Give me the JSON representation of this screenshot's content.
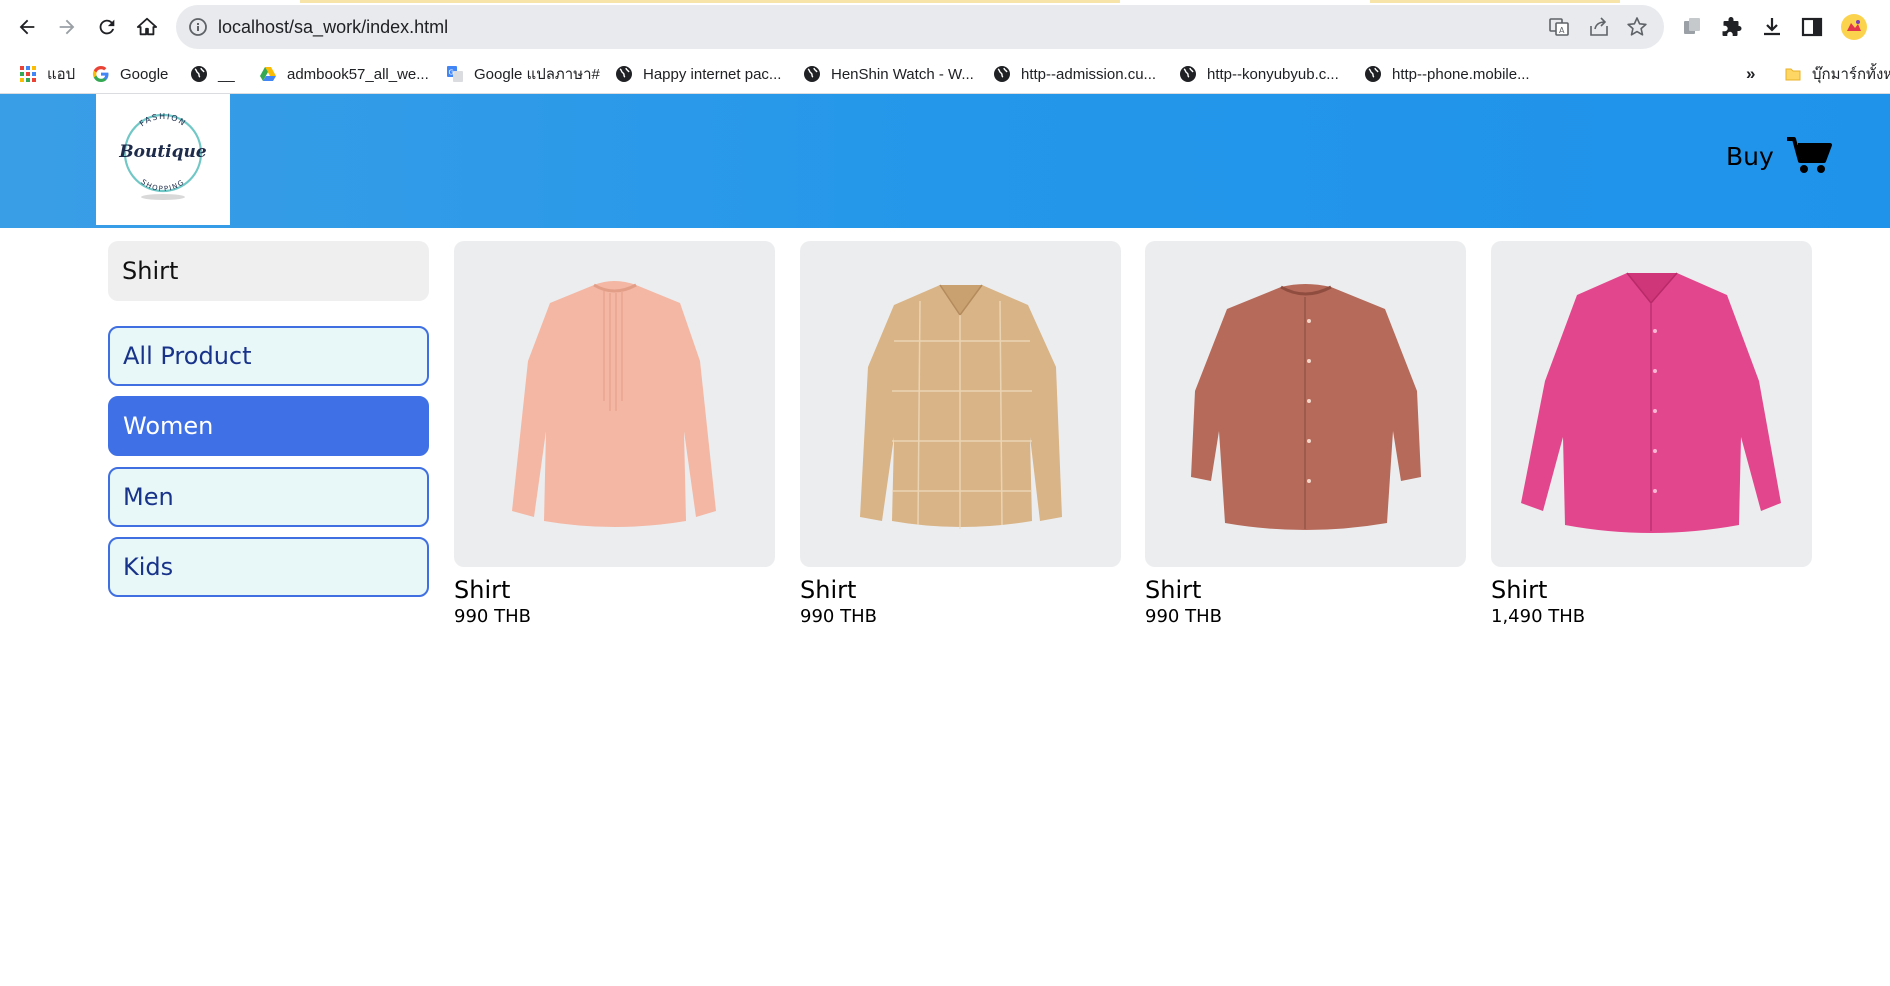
{
  "browser": {
    "url": "localhost/sa_work/index.html",
    "bookmarks": [
      {
        "label": "แอป",
        "icon": "apps-grid-icon"
      },
      {
        "label": "Google",
        "icon": "google-icon"
      },
      {
        "label": "__",
        "icon": "globe-icon"
      },
      {
        "label": "admbook57_all_we...",
        "icon": "drive-icon"
      },
      {
        "label": "Google แปลภาษา#",
        "icon": "translate-icon"
      },
      {
        "label": "Happy internet pac...",
        "icon": "globe-icon"
      },
      {
        "label": "HenShin Watch - W...",
        "icon": "globe-icon"
      },
      {
        "label": "http--admission.cu...",
        "icon": "globe-icon"
      },
      {
        "label": "http--konyubyub.c...",
        "icon": "globe-icon"
      },
      {
        "label": "http--phone.mobile...",
        "icon": "globe-icon"
      }
    ],
    "more_bookmarks": "»",
    "other_bookmarks": "บุ๊กมาร์กทั้งหม"
  },
  "header": {
    "logo_top_text": "FASHION",
    "logo_script_text": "Boutique",
    "logo_bottom_text": "SHOPPING",
    "buy_label": "Buy",
    "brand_color": "#2497ea"
  },
  "sidebar": {
    "search_value": "Shirt",
    "categories": [
      {
        "label": "All Product",
        "active": false
      },
      {
        "label": "Women",
        "active": true
      },
      {
        "label": "Men",
        "active": false
      },
      {
        "label": "Kids",
        "active": false
      }
    ]
  },
  "products": [
    {
      "name": "Shirt",
      "price": "990 THB",
      "color": "#f3b7a4"
    },
    {
      "name": "Shirt",
      "price": "990 THB",
      "color": "#d9b487"
    },
    {
      "name": "Shirt",
      "price": "990 THB",
      "color": "#b56a5a"
    },
    {
      "name": "Shirt",
      "price": "1,490 THB",
      "color": "#e2478d"
    }
  ]
}
